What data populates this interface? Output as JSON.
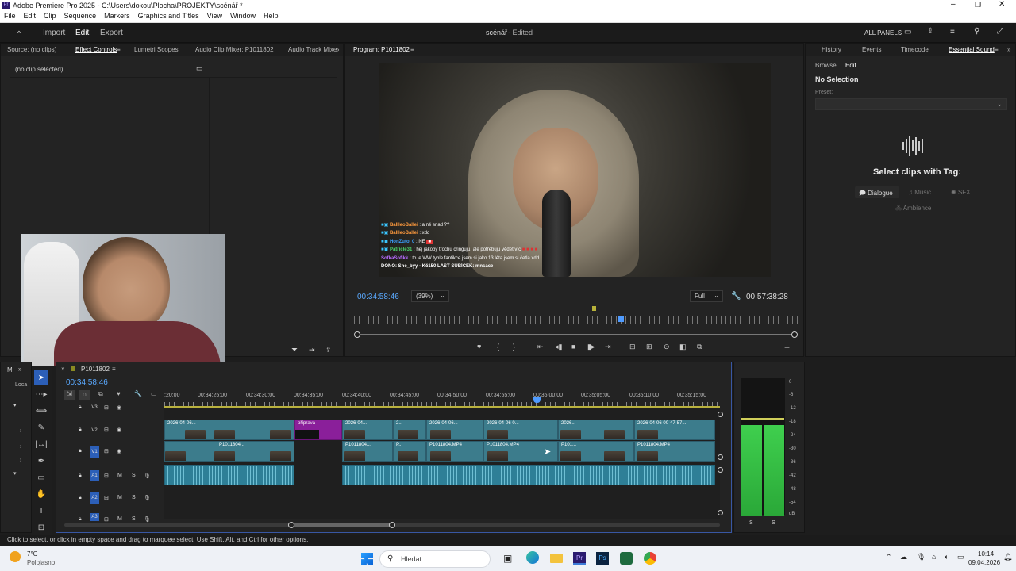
{
  "window": {
    "title": "Adobe Premiere Pro 2025 - C:\\Users\\dokou\\Plocha\\PROJEKTY\\scénář *"
  },
  "menu": [
    "File",
    "Edit",
    "Clip",
    "Sequence",
    "Markers",
    "Graphics and Titles",
    "View",
    "Window",
    "Help"
  ],
  "header": {
    "import": "Import",
    "edit": "Edit",
    "export": "Export",
    "project": "scénář",
    "state": "- Edited",
    "all_panels": "ALL PANELS"
  },
  "source_panel": {
    "tabs": [
      "Source: (no clips)",
      "Effect Controls",
      "Lumetri Scopes",
      "Audio Clip Mixer: P1011802",
      "Audio Track Mixe"
    ],
    "no_clip": "(no clip selected)"
  },
  "program": {
    "tab": "Program: P1011802",
    "timecode": "00:34:58:46",
    "zoom": "(39%)",
    "quality": "Full",
    "duration": "00:57:38:28"
  },
  "chat": [
    {
      "user": "BallleoBallei",
      "msg": " : a né snad ??"
    },
    {
      "user": "BallleoBallei",
      "msg": " : xdd"
    },
    {
      "user": "HonZuto_0",
      "msg": " : NE"
    },
    {
      "user": "Patricle31",
      "msg": " : hej jakoby trochu cringuju, ale potřebuju vědet víc"
    },
    {
      "user": "SofkaSofikk",
      "msg": " : to je WW tyhle fanfikce jsem si jako 13 léta jsem si četla xdd"
    }
  ],
  "chat_footer": "DONO: She_byy - Kč150   LAST SUBÍČEK: mnsace",
  "right_panel": {
    "tabs": [
      "History",
      "Events",
      "Timecode",
      "Essential Sound"
    ],
    "sub_tabs": [
      "Browse",
      "Edit"
    ],
    "no_selection": "No Selection",
    "preset": "Preset:",
    "select_tag": "Select clips with Tag:",
    "tags": [
      "Dialogue",
      "Music",
      "SFX",
      "Ambience"
    ]
  },
  "timeline": {
    "sequence": "P1011802",
    "timecode": "00:34:58:46",
    "ruler": [
      ":20:00",
      "00:34:25:00",
      "00:34:30:00",
      "00:34:35:00",
      "00:34:40:00",
      "00:34:45:00",
      "00:34:50:00",
      "00:34:55:00",
      "00:35:00:00",
      "00:35:05:00",
      "00:35:10:00",
      "00:35:15:00"
    ],
    "tracks": [
      "V3",
      "V2",
      "V1",
      "A1",
      "A2",
      "A3"
    ],
    "v2_clips": [
      {
        "label": "2026-04-06..."
      },
      {
        "label": "příprava"
      },
      {
        "label": "2026-04..."
      },
      {
        "label": "2..."
      },
      {
        "label": "2026-04-06..."
      },
      {
        "label": "2026-04-06 0..."
      },
      {
        "label": "2026..."
      },
      {
        "label": "2026-04-06 00-47-57..."
      }
    ],
    "v1_clips": [
      {
        "label": "P1011804..."
      },
      {
        "label": "P1011804..."
      },
      {
        "label": "P..."
      },
      {
        "label": "P1011804.MP4"
      },
      {
        "label": "P1011804.MP4"
      },
      {
        "label": "P101..."
      },
      {
        "label": "P1011804.MP4"
      }
    ],
    "mix_header": "Mi",
    "loc": "Loca"
  },
  "meter_scale": [
    "0",
    "-6",
    "-12",
    "-18",
    "-24",
    "-30",
    "-36",
    "-42",
    "-48",
    "-54",
    "dB"
  ],
  "meter_labels": [
    "S",
    "S"
  ],
  "status": "Click to select, or click in empty space and drag to marquee select. Use Shift, Alt, and Ctrl for other options.",
  "taskbar": {
    "temp": "7°C",
    "weather": "Polojasno",
    "search": "Hledat",
    "time": "10:14",
    "date": "09.04.2026"
  }
}
